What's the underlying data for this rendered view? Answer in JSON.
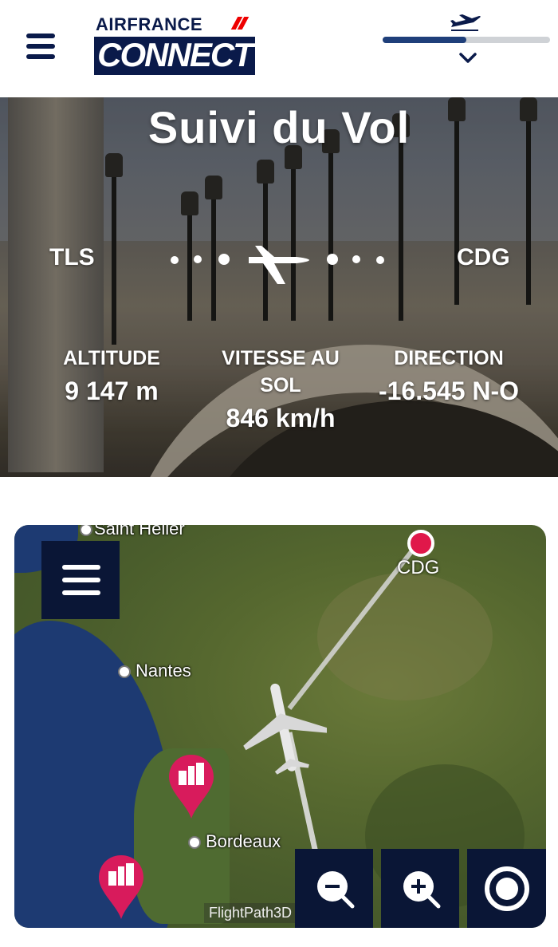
{
  "header": {
    "brand_top": "AIRFRANCE",
    "brand_bottom": "CONNECT",
    "flight_progress": 0.5,
    "accent_color": "#1f3f7a",
    "icons": [
      "menu-icon",
      "plane-icon",
      "chevron-down-icon"
    ]
  },
  "hero": {
    "title": "Suivi du Vol",
    "origin": "TLS",
    "destination": "CDG",
    "stats": [
      {
        "label": "ALTITUDE",
        "value": "9 147 m"
      },
      {
        "label": "VITESSE AU SOL",
        "value": "846 km/h"
      },
      {
        "label": "DIRECTION",
        "value": "-16.545 N-O"
      }
    ]
  },
  "map": {
    "cities": [
      "Saint Helier",
      "Nantes",
      "Bordeaux"
    ],
    "destination_label": "CDG",
    "attribution": "FlightPath3D",
    "marker_color": "#e0184a",
    "controls": [
      "zoom-out-icon",
      "zoom-in-icon",
      "recenter-icon"
    ]
  }
}
